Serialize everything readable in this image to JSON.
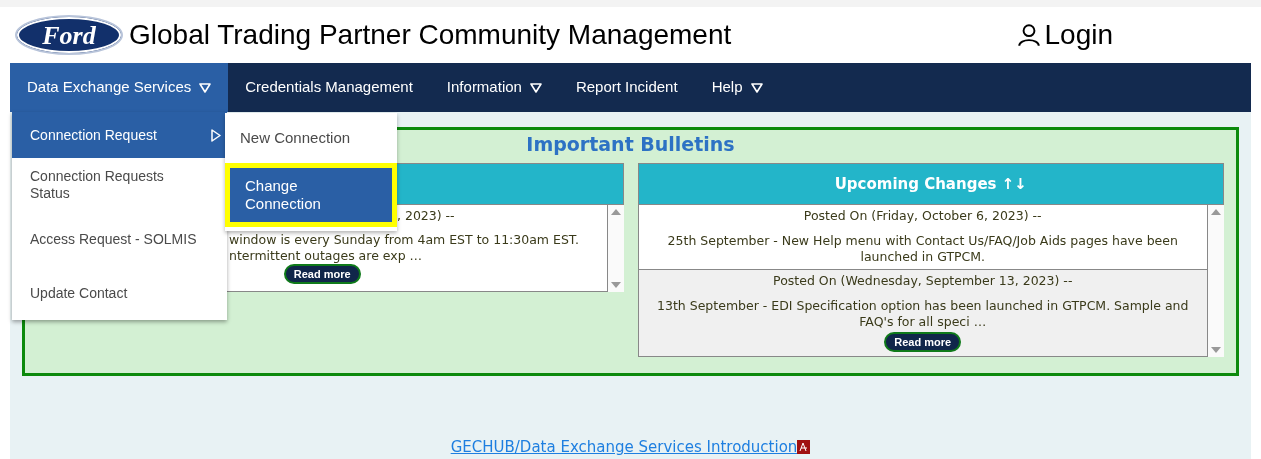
{
  "header": {
    "logo": "Ford",
    "title": "Global Trading Partner Community Management",
    "login": "Login"
  },
  "nav": [
    {
      "label": "Data Exchange Services",
      "dropdown": true,
      "selected": true
    },
    {
      "label": "Credentials Management",
      "dropdown": false,
      "selected": false
    },
    {
      "label": "Information",
      "dropdown": true,
      "selected": false
    },
    {
      "label": "Report Incident",
      "dropdown": false,
      "selected": false
    },
    {
      "label": "Help",
      "dropdown": true,
      "selected": false
    }
  ],
  "menu": [
    {
      "label": "Connection Request",
      "submenu": true,
      "selected": true
    },
    {
      "label": "Connection Requests Status",
      "submenu": false,
      "selected": false
    },
    {
      "label": "Access Request - SOLMIS",
      "submenu": false,
      "selected": false
    },
    {
      "label": "Update Contact",
      "submenu": false,
      "selected": false
    }
  ],
  "submenu": [
    {
      "label": "New Connection",
      "selected": false
    },
    {
      "label": "Change Connection",
      "selected": true
    }
  ],
  "bulletins": {
    "title": "Important Bulletins",
    "left_panel": {
      "posts": [
        {
          "date": ", 2023) --",
          "lines": [
            "window is every Sunday from 4am EST to 11:30am EST.",
            "ntermittent outages are exp …"
          ],
          "button": "Read more"
        }
      ]
    },
    "right_panel": {
      "heading": "Upcoming Changes ↑↓",
      "posts": [
        {
          "date": "Posted On (Friday, October 6, 2023) --",
          "body": "25th September - New Help menu with Contact Us/FAQ/Job Aids pages have been launched in GTPCM."
        },
        {
          "date": "Posted On (Wednesday, September 13, 2023) --",
          "body": "13th September - EDI Specification option has been launched in GTPCM. Sample and FAQ's for all speci …",
          "button": "Read more"
        }
      ]
    }
  },
  "footer_link": "GECHUB/Data Exchange Services Introduction"
}
